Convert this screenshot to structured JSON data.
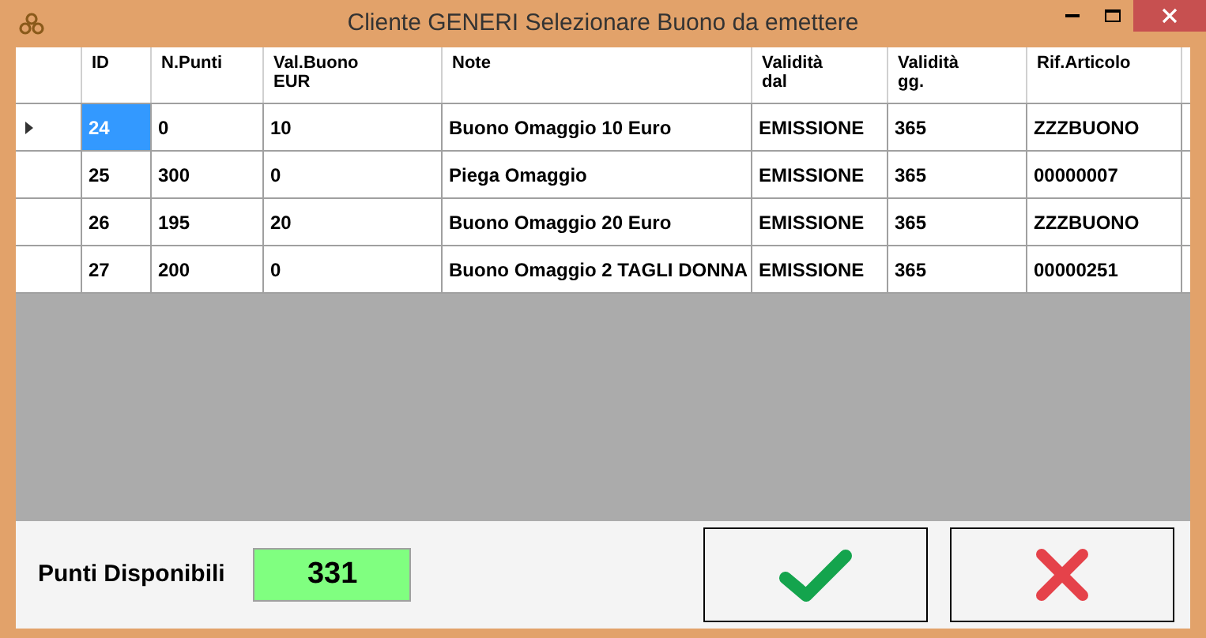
{
  "window": {
    "title": "Cliente GENERI Selezionare Buono da emettere"
  },
  "table": {
    "columns": [
      "ID",
      "N.Punti",
      "Val.Buono EUR",
      "Note",
      "Validità dal",
      "Validità gg.",
      "Rif.Articolo"
    ],
    "rows": [
      {
        "selected": true,
        "cells": [
          "24",
          "0",
          "10",
          "Buono Omaggio 10 Euro",
          "EMISSIONE",
          "365",
          "ZZZBUONO"
        ]
      },
      {
        "selected": false,
        "cells": [
          "25",
          "300",
          "0",
          "Piega Omaggio",
          "EMISSIONE",
          "365",
          "00000007"
        ]
      },
      {
        "selected": false,
        "cells": [
          "26",
          "195",
          "20",
          "Buono Omaggio 20 Euro",
          "EMISSIONE",
          "365",
          "ZZZBUONO"
        ]
      },
      {
        "selected": false,
        "cells": [
          "27",
          "200",
          "0",
          "Buono Omaggio 2 TAGLI DONNA",
          "EMISSIONE",
          "365",
          "00000251"
        ]
      }
    ]
  },
  "footer": {
    "label": "Punti Disponibili",
    "value": "331"
  }
}
